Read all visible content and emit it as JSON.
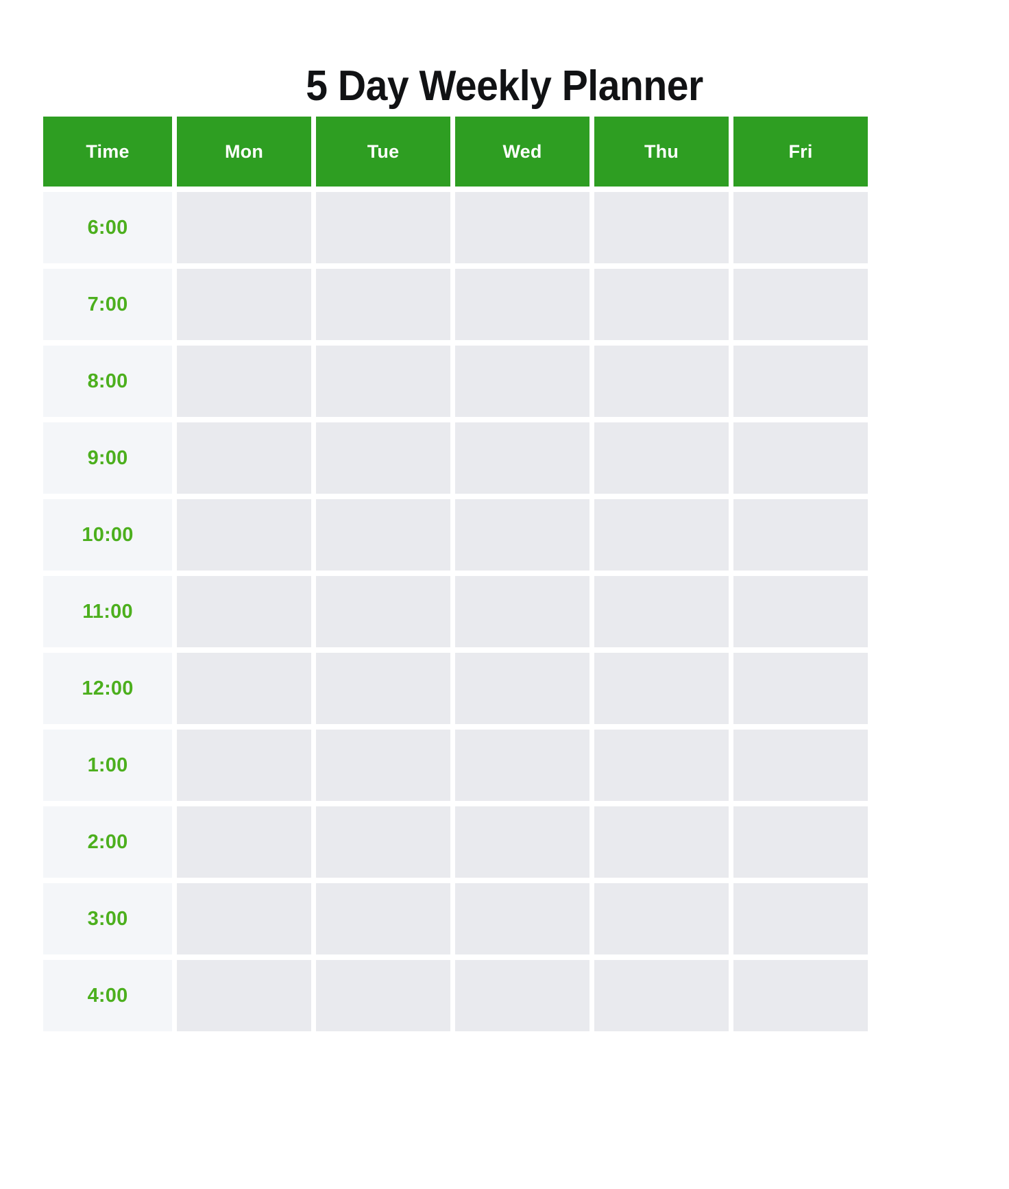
{
  "page": {
    "title": "5 Day Weekly Planner",
    "background_color": "#ffffff"
  },
  "theme": {
    "header_green": "#2e9e22",
    "time_text_green": "#4caf1e",
    "time_cell_background": "#f4f6f9",
    "day_cell_background": "#e9eaee",
    "title_color": "#111214"
  },
  "table": {
    "columns": [
      {
        "key": "time",
        "label": "Time"
      },
      {
        "key": "mon",
        "label": "Mon"
      },
      {
        "key": "tue",
        "label": "Tue"
      },
      {
        "key": "wed",
        "label": "Wed"
      },
      {
        "key": "thu",
        "label": "Thu"
      },
      {
        "key": "fri",
        "label": "Fri"
      }
    ],
    "rows": [
      {
        "time": "6:00",
        "mon": "",
        "tue": "",
        "wed": "",
        "thu": "",
        "fri": ""
      },
      {
        "time": "7:00",
        "mon": "",
        "tue": "",
        "wed": "",
        "thu": "",
        "fri": ""
      },
      {
        "time": "8:00",
        "mon": "",
        "tue": "",
        "wed": "",
        "thu": "",
        "fri": ""
      },
      {
        "time": "9:00",
        "mon": "",
        "tue": "",
        "wed": "",
        "thu": "",
        "fri": ""
      },
      {
        "time": "10:00",
        "mon": "",
        "tue": "",
        "wed": "",
        "thu": "",
        "fri": ""
      },
      {
        "time": "11:00",
        "mon": "",
        "tue": "",
        "wed": "",
        "thu": "",
        "fri": ""
      },
      {
        "time": "12:00",
        "mon": "",
        "tue": "",
        "wed": "",
        "thu": "",
        "fri": ""
      },
      {
        "time": "1:00",
        "mon": "",
        "tue": "",
        "wed": "",
        "thu": "",
        "fri": ""
      },
      {
        "time": "2:00",
        "mon": "",
        "tue": "",
        "wed": "",
        "thu": "",
        "fri": ""
      },
      {
        "time": "3:00",
        "mon": "",
        "tue": "",
        "wed": "",
        "thu": "",
        "fri": ""
      },
      {
        "time": "4:00",
        "mon": "",
        "tue": "",
        "wed": "",
        "thu": "",
        "fri": ""
      }
    ]
  }
}
